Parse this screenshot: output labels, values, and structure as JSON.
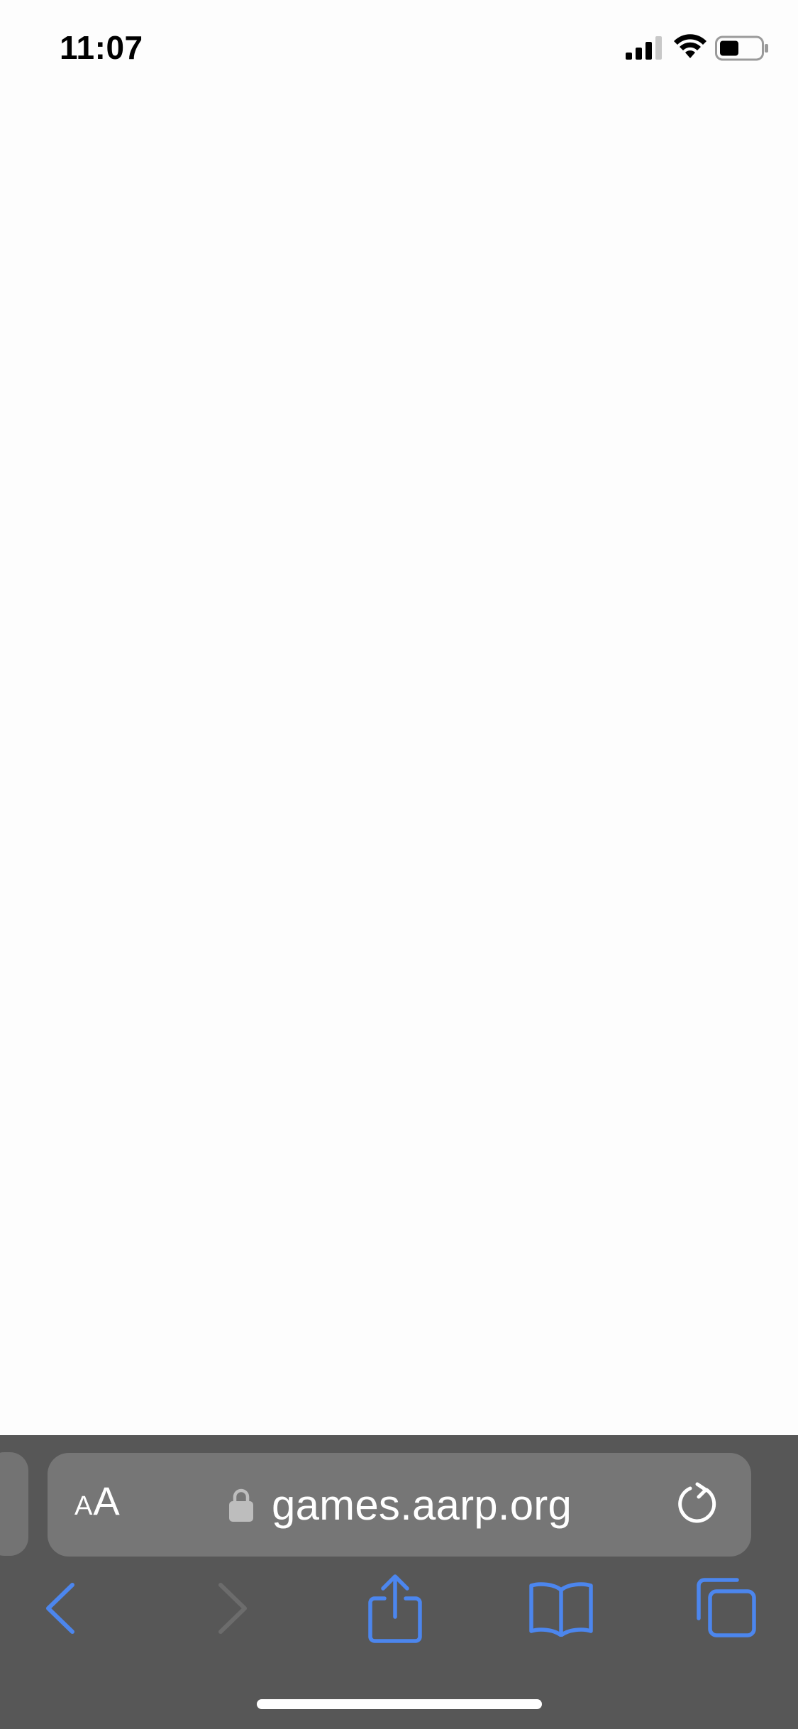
{
  "status_bar": {
    "time": "11:07",
    "icons": [
      "cellular-signal-icon",
      "wifi-icon",
      "battery-icon"
    ]
  },
  "browser": {
    "reader_label_small": "A",
    "reader_label_large": "A",
    "url": "games.aarp.org",
    "icons": {
      "lock": "lock-icon",
      "reload": "reload-icon",
      "back": "chevron-left-icon",
      "forward": "chevron-right-icon",
      "share": "share-icon",
      "bookmarks": "book-icon",
      "tabs": "tabs-icon"
    }
  },
  "colors": {
    "accent": "#4c86ee",
    "toolbar_bg": "#575757",
    "address_bar_bg": "#767676",
    "disabled": "#6c6c6c",
    "page_bg": "#fdfdfd"
  }
}
